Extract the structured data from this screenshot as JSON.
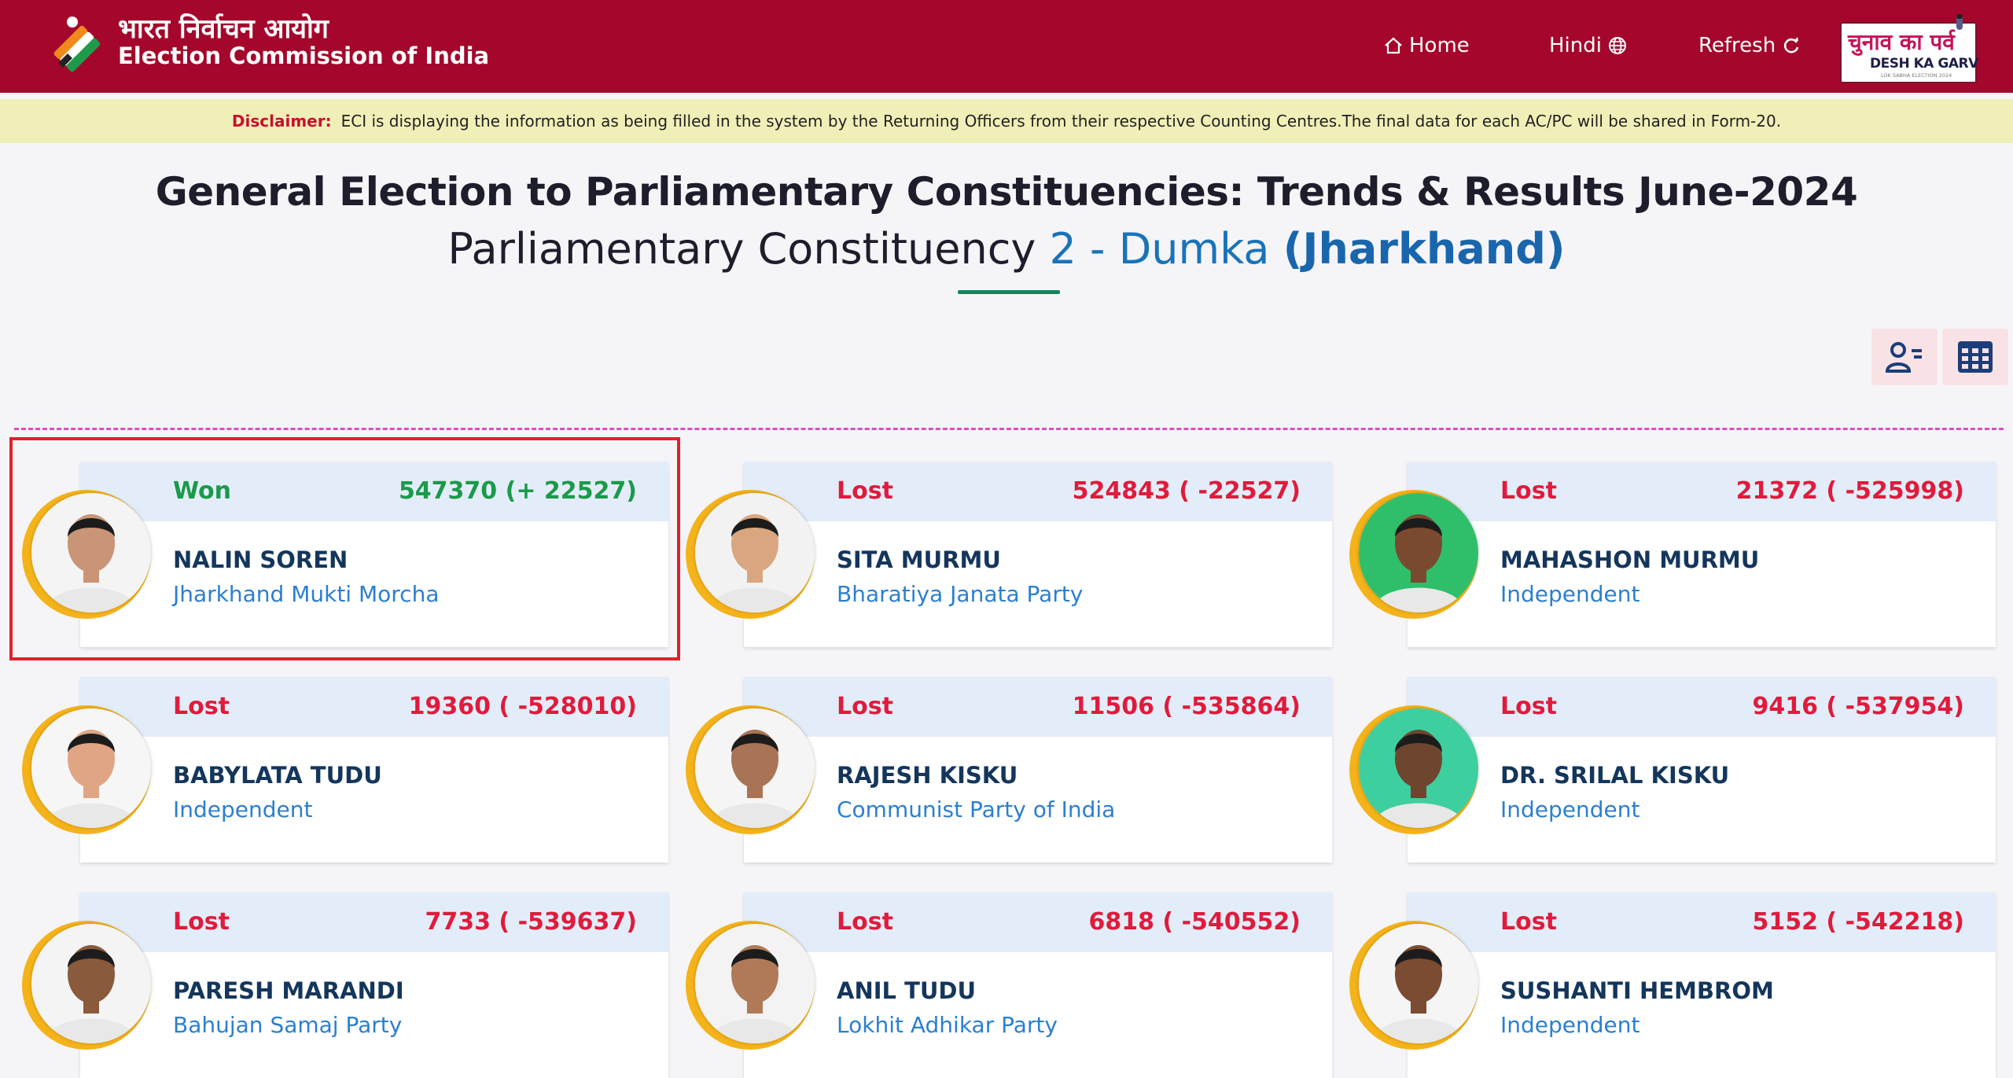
{
  "header": {
    "logo_hindi": "भारत निर्वाचन आयोग",
    "logo_english": "Election Commission of India",
    "nav": {
      "home": "Home",
      "hindi": "Hindi",
      "refresh": "Refresh"
    },
    "badge": {
      "hindi": "चुनाव का पर्व",
      "english": "DESH KA GARV",
      "sub": "LOK SABHA ELECTION 2024"
    }
  },
  "disclaimer": {
    "label": "Disclaimer:",
    "text": "ECI is displaying the information as being filled in the system by the Returning Officers from their respective Counting Centres.The final data for each AC/PC will be shared in Form-20."
  },
  "title": {
    "line1": "General Election to Parliamentary Constituencies: Trends & Results June-2024",
    "line2_prefix": "Parliamentary Constituency",
    "line2_constituency": "2 - Dumka",
    "line2_state": "(Jharkhand)"
  },
  "colors": {
    "header_bg": "#a4072b",
    "won": "#1a9a4a",
    "lost": "#e01b3c",
    "name": "#14365c",
    "party": "#2b7fd1",
    "ring": "#f5b31a"
  },
  "candidates": [
    {
      "status": "Won",
      "votes": "547370 (+ 22527)",
      "name": "NALIN SOREN",
      "party": "Jharkhand Mukti Morcha"
    },
    {
      "status": "Lost",
      "votes": "524843 ( -22527)",
      "name": "SITA MURMU",
      "party": "Bharatiya Janata Party"
    },
    {
      "status": "Lost",
      "votes": "21372 ( -525998)",
      "name": "MAHASHON MURMU",
      "party": "Independent"
    },
    {
      "status": "Lost",
      "votes": "19360 ( -528010)",
      "name": "BABYLATA TUDU",
      "party": "Independent"
    },
    {
      "status": "Lost",
      "votes": "11506 ( -535864)",
      "name": "RAJESH KISKU",
      "party": "Communist Party of India"
    },
    {
      "status": "Lost",
      "votes": "9416 ( -537954)",
      "name": "DR. SRILAL KISKU",
      "party": "Independent"
    },
    {
      "status": "Lost",
      "votes": "7733 ( -539637)",
      "name": "PARESH MARANDI",
      "party": "Bahujan Samaj Party"
    },
    {
      "status": "Lost",
      "votes": "6818 ( -540552)",
      "name": "ANIL TUDU",
      "party": "Lokhit Adhikar Party"
    },
    {
      "status": "Lost",
      "votes": "5152 ( -542218)",
      "name": "SUSHANTI HEMBROM",
      "party": "Independent"
    }
  ]
}
